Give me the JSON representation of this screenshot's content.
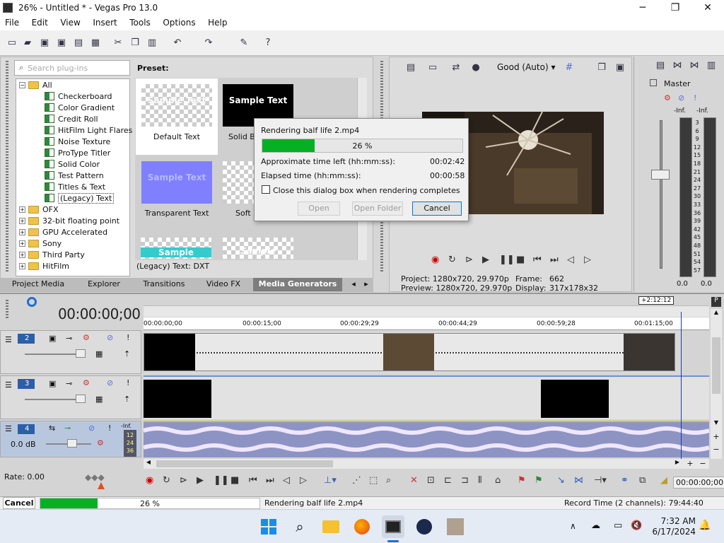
{
  "window": {
    "title": "26% - Untitled * - Vegas Pro 13.0",
    "minimize": "─",
    "maximize": "❐",
    "close": "✕"
  },
  "menu": [
    "File",
    "Edit",
    "View",
    "Insert",
    "Tools",
    "Options",
    "Help"
  ],
  "plugin_panel": {
    "search_placeholder": "Search plug-ins",
    "preset_label": "Preset:",
    "tree": {
      "root": "All",
      "children": [
        "Checkerboard",
        "Color Gradient",
        "Credit Roll",
        "HitFilm Light Flares",
        "Noise Texture",
        "ProType Titler",
        "Solid Color",
        "Test Pattern",
        "Titles & Text",
        "(Legacy) Text"
      ],
      "groups": [
        "OFX",
        "32-bit floating point",
        "GPU Accelerated",
        "Sony",
        "Third Party",
        "HitFilm"
      ]
    },
    "presets": [
      {
        "name": "Default Text",
        "thumb_text": "Sample Text"
      },
      {
        "name": "Solid Ba",
        "thumb_text": "Sample Text"
      },
      {
        "name": "Transparent Text",
        "thumb_text": "Sample Text"
      },
      {
        "name": "Soft S",
        "thumb_text": ""
      },
      {
        "name": "",
        "thumb_text": "Sample"
      },
      {
        "name": "",
        "thumb_text": "Sample"
      }
    ],
    "status": "(Legacy) Text: DXT"
  },
  "tabs": [
    "Project Media",
    "Explorer",
    "Transitions",
    "Video FX",
    "Media Generators"
  ],
  "render_dialog": {
    "title": "Rendering balf life 2.mp4",
    "progress": 26,
    "progress_text": "26 %",
    "time_left_label": "Approximate time left (hh:mm:ss):",
    "time_left": "00:02:42",
    "elapsed_label": "Elapsed time (hh:mm:ss):",
    "elapsed": "00:00:58",
    "close_checkbox": "Close this dialog box when rendering completes",
    "open_btn": "Open",
    "open_folder_btn": "Open Folder",
    "cancel_btn": "Cancel"
  },
  "preview": {
    "quality": "Good (Auto)",
    "project_label": "Project:",
    "project": "1280x720, 29.970p",
    "preview_label": "Preview:",
    "preview_val": "1280x720, 29.970p",
    "frame_label": "Frame:",
    "frame": "662",
    "display_label": "Display:",
    "display": "317x178x32"
  },
  "master": {
    "label": "Master",
    "inf_left": "-Inf.",
    "inf_right": "-Inf.",
    "scale": [
      "3",
      "6",
      "9",
      "12",
      "15",
      "18",
      "21",
      "24",
      "27",
      "30",
      "33",
      "36",
      "39",
      "42",
      "45",
      "48",
      "51",
      "54",
      "57"
    ],
    "val_left": "0.0",
    "val_right": "0.0"
  },
  "timeline": {
    "timecode": "00:00:00;00",
    "end_marker": "+2:12:12",
    "ticks": [
      "00:00:00;00",
      "00:00:15;00",
      "00:00:29;29",
      "00:00:44;29",
      "00:00:59;28",
      "00:01:15;00"
    ],
    "tracks": [
      {
        "num": "2"
      },
      {
        "num": "3"
      },
      {
        "num": "4",
        "db": "0.0 dB",
        "inf": "-Inf."
      }
    ],
    "audio_scale": [
      "12",
      "24",
      "36"
    ],
    "rate": "Rate: 0.00",
    "end_timecode": "00:00:00;00"
  },
  "status": {
    "cancel": "Cancel",
    "progress": 26,
    "progress_text": "26 %",
    "message": "Rendering balf life 2.mp4",
    "record_time": "Record Time (2 channels): 79:44:40"
  },
  "taskbar": {
    "time": "7:32 AM",
    "date": "6/17/2024"
  }
}
